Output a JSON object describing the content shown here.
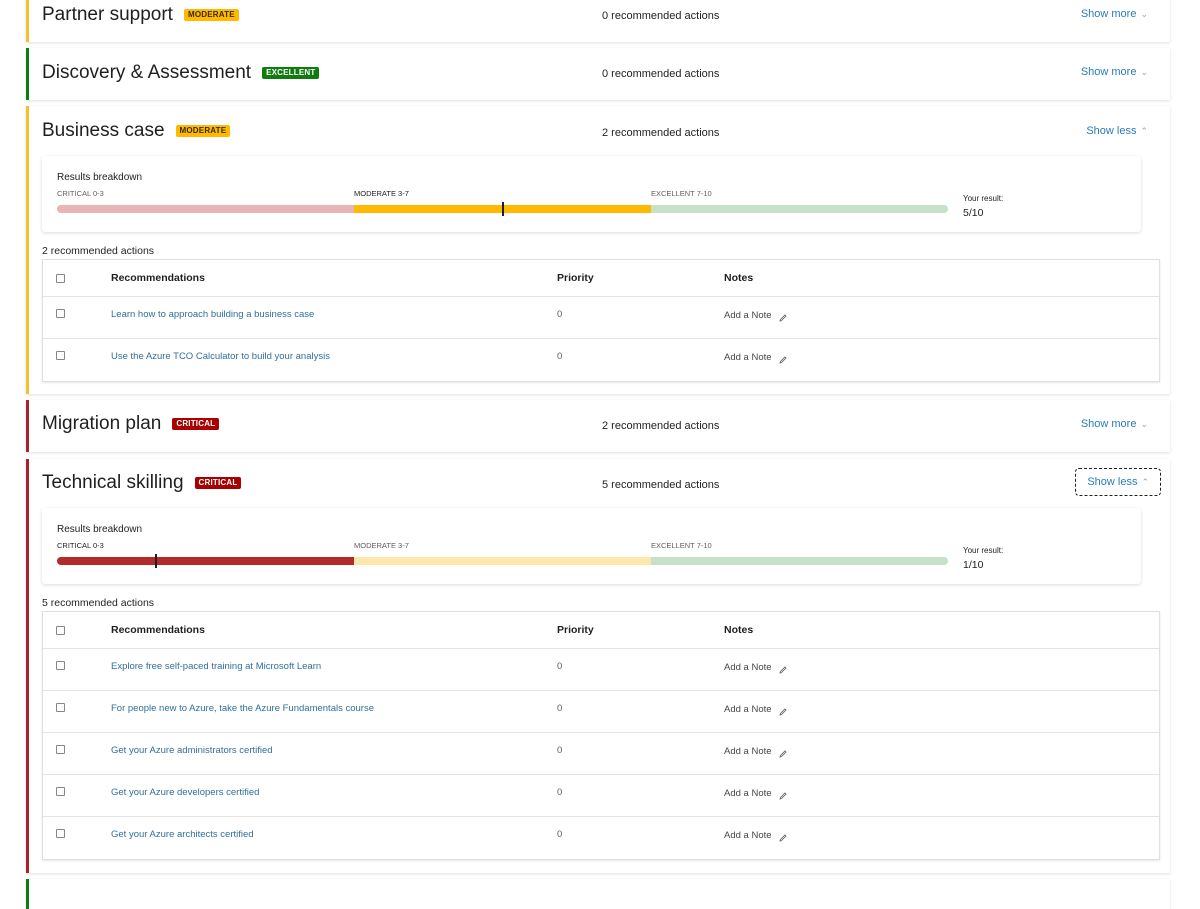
{
  "sections": [
    {
      "title": "Partner support",
      "status": "MODERATE",
      "recommended_count_label": "0 recommended actions",
      "toggle_label": "Show more",
      "toggle_icon": "chevron-down-icon"
    },
    {
      "title": "Discovery & Assessment",
      "status": "EXCELLENT",
      "recommended_count_label": "0 recommended actions",
      "toggle_label": "Show more",
      "toggle_icon": "chevron-down-icon"
    },
    {
      "title": "Business case",
      "status": "MODERATE",
      "recommended_count_label": "2 recommended actions",
      "toggle_label": "Show less",
      "toggle_icon": "chevron-up-icon",
      "breakdown": {
        "title": "Results breakdown",
        "ranges": [
          {
            "label": "CRITICAL 0-3",
            "from": 0,
            "to": 3
          },
          {
            "label": "MODERATE 3-7",
            "from": 3,
            "to": 7
          },
          {
            "label": "EXCELLENT 7-10",
            "from": 7,
            "to": 10
          }
        ],
        "your_result_label": "Your result:",
        "score": 5,
        "max": 10,
        "score_label": "5/10"
      },
      "actions_label": "2 recommended actions",
      "table": {
        "columns": [
          "Recommendations",
          "Priority",
          "Notes"
        ],
        "rows": [
          {
            "recommendation": "Learn how to approach building a business case",
            "priority": "0",
            "note": "Add a Note"
          },
          {
            "recommendation": "Use the Azure TCO Calculator to build your analysis",
            "priority": "0",
            "note": "Add a Note"
          }
        ]
      }
    },
    {
      "title": "Migration plan",
      "status": "CRITICAL",
      "recommended_count_label": "2 recommended actions",
      "toggle_label": "Show more",
      "toggle_icon": "chevron-down-icon"
    },
    {
      "title": "Technical skilling",
      "status": "CRITICAL",
      "recommended_count_label": "5 recommended actions",
      "toggle_label": "Show less",
      "toggle_icon": "chevron-up-icon",
      "breakdown": {
        "title": "Results breakdown",
        "ranges": [
          {
            "label": "CRITICAL 0-3",
            "from": 0,
            "to": 3
          },
          {
            "label": "MODERATE 3-7",
            "from": 3,
            "to": 7
          },
          {
            "label": "EXCELLENT 7-10",
            "from": 7,
            "to": 10
          }
        ],
        "your_result_label": "Your result:",
        "score": 1,
        "max": 10,
        "score_label": "1/10"
      },
      "actions_label": "5 recommended actions",
      "table": {
        "columns": [
          "Recommendations",
          "Priority",
          "Notes"
        ],
        "rows": [
          {
            "recommendation": "Explore free self-paced training at Microsoft Learn",
            "priority": "0",
            "note": "Add a Note"
          },
          {
            "recommendation": "For people new to Azure, take the Azure Fundamentals course",
            "priority": "0",
            "note": "Add a Note"
          },
          {
            "recommendation": "Get your Azure administrators certified",
            "priority": "0",
            "note": "Add a Note"
          },
          {
            "recommendation": "Get your Azure developers certified",
            "priority": "0",
            "note": "Add a Note"
          },
          {
            "recommendation": "Get your Azure architects certified",
            "priority": "0",
            "note": "Add a Note"
          }
        ]
      }
    }
  ],
  "colors": {
    "moderate": "#ffb900",
    "excellent": "#107c10",
    "critical": "#a80000",
    "link": "#2b7bb9",
    "bar_critical_active": "#b22a2a",
    "bar_critical_dim": "#e8b4b6",
    "bar_moderate_active": "#ffb900",
    "bar_moderate_dim": "#fde7ab",
    "bar_excellent_dim": "#c6e1c6"
  }
}
